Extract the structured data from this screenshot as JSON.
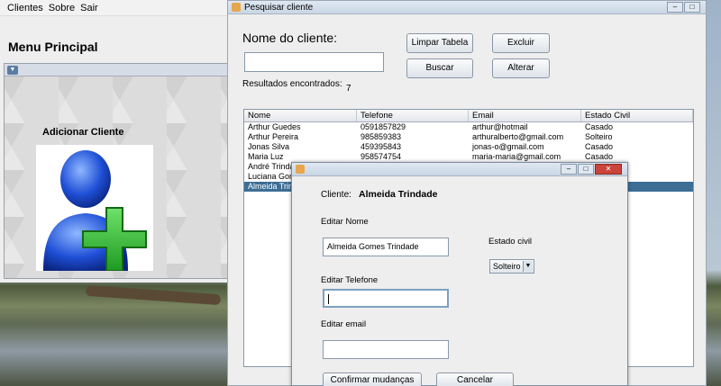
{
  "main_window": {
    "menu": [
      "Clientes",
      "Sobre",
      "Sair"
    ],
    "title": "Menu Principal",
    "add_client_label": "Adicionar Cliente"
  },
  "search_window": {
    "title": "Pesquisar cliente",
    "client_name_label": "Nome do cliente:",
    "client_name_value": "",
    "buttons": {
      "clear": "Limpar Tabela",
      "search": "Buscar",
      "delete": "Excluir",
      "edit": "Alterar"
    },
    "results_label": "Resultados encontrados:",
    "results_count": "7",
    "table": {
      "columns": [
        "Nome",
        "Telefone",
        "Email",
        "Estado Civil"
      ],
      "rows": [
        [
          "Arthur Guedes",
          "0591857829",
          "arthur@hotmail",
          "Casado"
        ],
        [
          "Arthur Pereira",
          "985859383",
          "arthuralberto@gmail.com",
          "Solteiro"
        ],
        [
          "Jonas Silva",
          "459395843",
          "jonas-o@gmail.com",
          "Casado"
        ],
        [
          "Maria Luz",
          "958574754",
          "maria-maria@gmail.com",
          "Casado"
        ],
        [
          "André Trindade",
          "",
          "",
          ""
        ],
        [
          "Luciana Gomes",
          "",
          "",
          ""
        ],
        [
          "Almeida Trindade",
          "",
          "",
          ""
        ]
      ],
      "selected_row": 6
    }
  },
  "edit_dialog": {
    "client_label": "Cliente:",
    "client_name": "Almeida Trindade",
    "edit_name_label": "Editar Nome",
    "edit_name_value": "Almeida Gomes Trindade",
    "marital_label": "Estado civil",
    "marital_value": "Solteiro",
    "edit_phone_label": "Editar Telefone",
    "edit_phone_value": "",
    "edit_email_label": "Editar email",
    "edit_email_value": "",
    "confirm_button": "Confirmar mudanças",
    "cancel_button": "Cancelar"
  }
}
